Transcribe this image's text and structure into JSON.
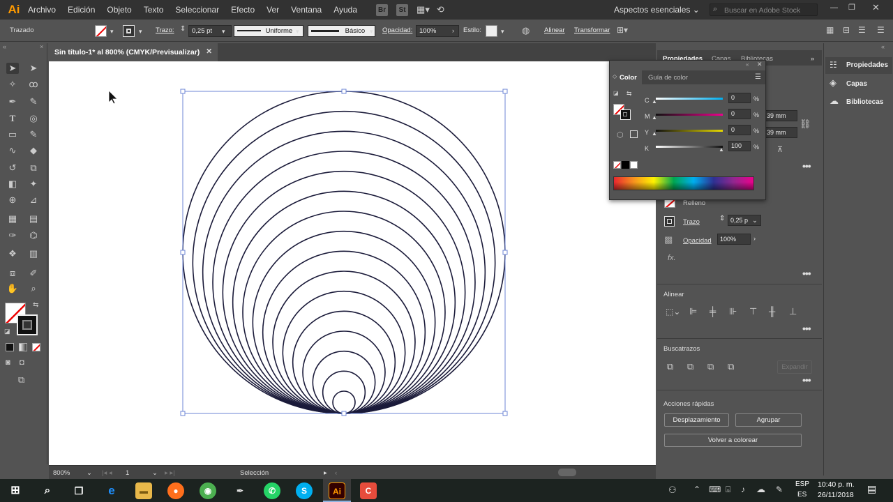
{
  "menubar": {
    "logo": "Ai",
    "items": [
      "Archivo",
      "Edición",
      "Objeto",
      "Texto",
      "Seleccionar",
      "Efecto",
      "Ver",
      "Ventana",
      "Ayuda"
    ],
    "bridge": "Br",
    "stock": "St",
    "workspace": "Aspectos esenciales",
    "search_placeholder": "Buscar en Adobe Stock"
  },
  "controlbar": {
    "object_type": "Trazado",
    "stroke_label": "Trazo:",
    "stroke_value": "0,25 pt",
    "profile_uniform": "Uniforme",
    "brush_basic": "Básico",
    "opacity_label": "Opacidad:",
    "opacity_value": "100%",
    "style_label": "Estilo:",
    "align_label": "Alinear",
    "transform_label": "Transformar"
  },
  "document": {
    "tab_title": "Sin título-1* al 800% (CMYK/Previsualizar)"
  },
  "statusbar": {
    "zoom": "800%",
    "artboard": "1",
    "mode": "Selección"
  },
  "color_panel": {
    "tab_color": "Color",
    "tab_guide": "Guía de color",
    "channels": [
      {
        "label": "C",
        "value": "0"
      },
      {
        "label": "M",
        "value": "0"
      },
      {
        "label": "Y",
        "value": "0"
      },
      {
        "label": "K",
        "value": "100"
      }
    ],
    "percent": "%"
  },
  "properties_panel": {
    "tabs": [
      "Propiedades",
      "Capas",
      "Bibliotecas"
    ],
    "w_value": "39 mm",
    "h_value": "39 mm",
    "fill_label": "Relleno",
    "stroke_label": "Trazo",
    "stroke_value": "0,25 p",
    "opacity_label": "Opacidad",
    "opacity_value": "100%",
    "fx_label": "fx.",
    "align_title": "Alinear",
    "pathfinder_title": "Buscatrazos",
    "expand_label": "Expandir",
    "quick_actions_title": "Acciones rápidas",
    "offset_button": "Desplazamiento",
    "group_button": "Agrupar",
    "recolor_button": "Volver a colorear"
  },
  "dock": {
    "items": [
      "Propiedades",
      "Capas",
      "Bibliotecas"
    ]
  },
  "taskbar": {
    "lang_top": "ESP",
    "lang_bottom": "ES",
    "time": "10:40 p. m.",
    "date": "26/11/2018"
  }
}
